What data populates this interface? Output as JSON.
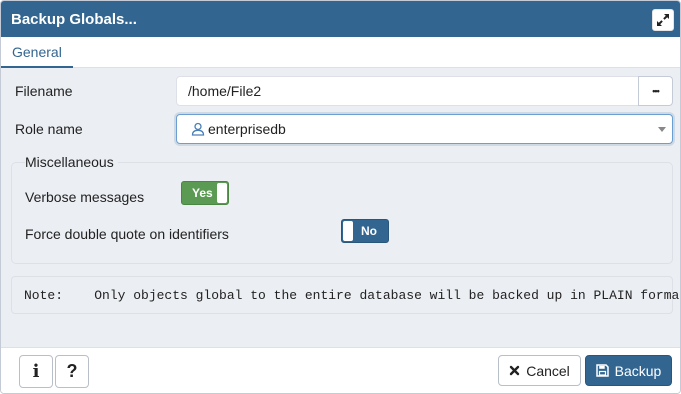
{
  "dialog": {
    "title": "Backup Globals...",
    "maximize_icon": "expand-arrows-icon"
  },
  "tabs": [
    {
      "label": "General",
      "active": true
    }
  ],
  "form": {
    "filename_label": "Filename",
    "filename_value": "/home/File2",
    "browse_label": "•••",
    "role_label": "Role name",
    "role_value": "enterprisedb",
    "role_icon": "user-icon",
    "misc_legend": "Miscellaneous",
    "verbose_label": "Verbose messages",
    "verbose_value": "Yes",
    "verbose_on": true,
    "quote_label": "Force double quote on identifiers",
    "quote_value": "No",
    "quote_on": false,
    "note": "Note:    Only objects global to the entire database will be backed up in PLAIN format"
  },
  "footer": {
    "info_label": "i",
    "help_label": "?",
    "cancel_label": "Cancel",
    "cancel_icon": "close-x-icon",
    "backup_label": "Backup",
    "backup_icon": "floppy-disk-icon"
  },
  "colors": {
    "header": "#326690",
    "content_bg": "#ebeef3",
    "switch_on": "#5b9a52",
    "switch_off": "#326690",
    "primary_button": "#326690"
  }
}
